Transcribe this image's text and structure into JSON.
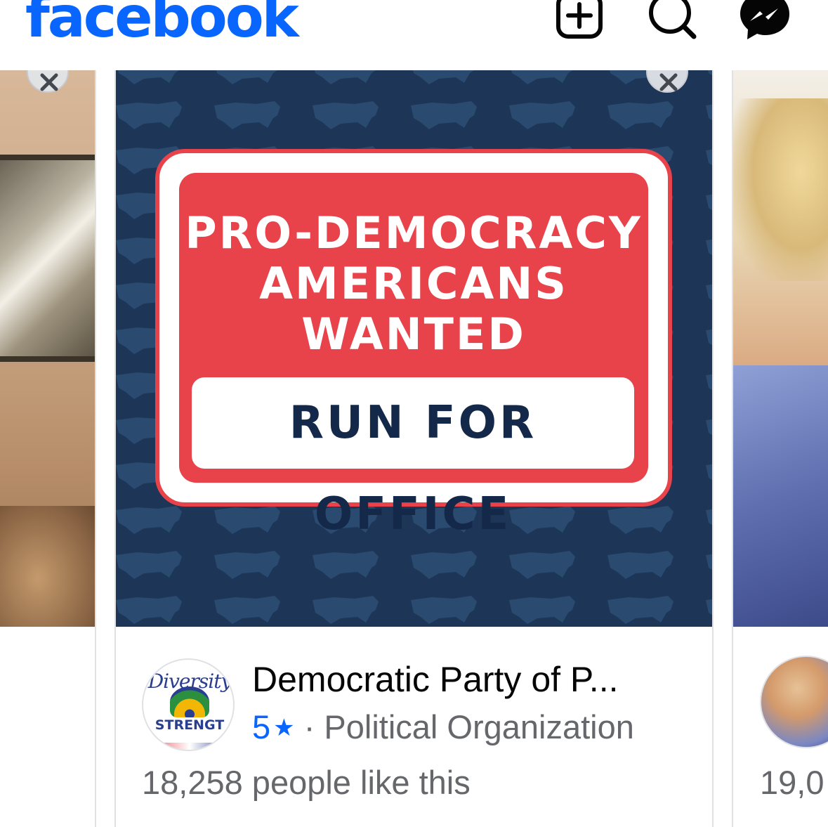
{
  "header": {
    "logo": "facebook",
    "icons": [
      "add-icon",
      "search-icon",
      "messenger-icon"
    ],
    "brand_color": "#0866ff"
  },
  "carousel": {
    "main_card": {
      "ad": {
        "headline": "PRO-DEMOCRACY AMERICANS WANTED",
        "cta_text": "RUN FOR OFFICE",
        "colors": {
          "background": "#1d3556",
          "sign_red": "#e8424a",
          "sign_text_dark": "#14294a"
        }
      },
      "avatar": {
        "script_text": "Diversity",
        "banner_text": "STRENGT"
      },
      "page_name": "Democratic Party of P...",
      "rating": "5",
      "separator": "·",
      "category": "Political Organization",
      "likes": "18,258 people like this"
    },
    "right_card": {
      "likes_partial": "19,0"
    }
  }
}
